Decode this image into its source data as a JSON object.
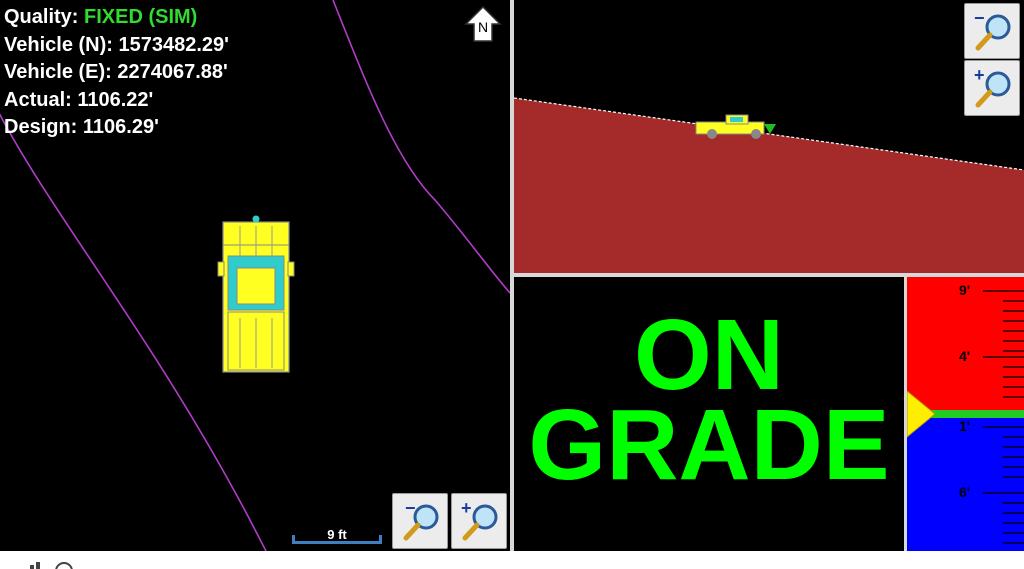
{
  "plan_view": {
    "quality_label": "Quality:",
    "quality_value": "FIXED (SIM)",
    "vehicle_n_label": "Vehicle (N):",
    "vehicle_n_value": "1573482.29'",
    "vehicle_e_label": "Vehicle (E):",
    "vehicle_e_value": "2274067.88'",
    "actual_label": "Actual:",
    "actual_value": "1106.22'",
    "design_label": "Design:",
    "design_value": "1106.29'",
    "north_label": "N",
    "scale_label": "9 ft",
    "zoom_out_sign": "−",
    "zoom_in_sign": "+"
  },
  "profile_view": {
    "zoom_out_sign": "−",
    "zoom_in_sign": "+"
  },
  "status": {
    "line1": "ON",
    "line2": "GRADE",
    "color": "#00ff00"
  },
  "gauge": {
    "tick_top": "9'",
    "tick_upper": "4'",
    "tick_lower": "1'",
    "tick_bottom": "6'",
    "above_color": "#ff0000",
    "below_color": "#0000ff",
    "on_grade_color": "#22cc22",
    "pointer_color": "#ffee00"
  },
  "colors": {
    "ground": "#a52a2a",
    "boundary": "#b03cc8",
    "vehicle": "#ffff22",
    "cab_glass": "#2ecccc",
    "scale_bar": "#3f7fc0"
  }
}
